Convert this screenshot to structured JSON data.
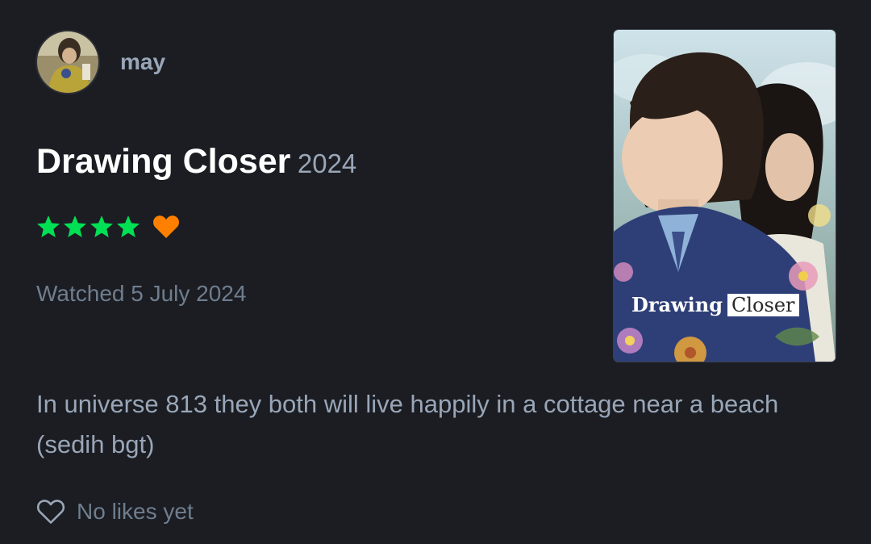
{
  "user": {
    "name": "may"
  },
  "film": {
    "title": "Drawing Closer",
    "year": "2024"
  },
  "rating": {
    "stars": 4,
    "max_stars": 5,
    "liked": true
  },
  "watched_text": "Watched 5 July 2024",
  "poster": {
    "title_left": "Drawing",
    "title_right": "Closer"
  },
  "review_text": "In universe 813 they both will live happily in a cottage near a beach (sedih bgt)",
  "likes": {
    "label": "No likes yet"
  },
  "colors": {
    "background": "#1b1d22",
    "star": "#00e054",
    "heart": "#ff8000",
    "text_primary": "#ffffff",
    "text_secondary": "#99a6b8",
    "text_muted": "#6f7d8e"
  },
  "icons": {
    "star": "star-icon",
    "heart": "heart-icon",
    "like": "heart-outline-icon"
  }
}
